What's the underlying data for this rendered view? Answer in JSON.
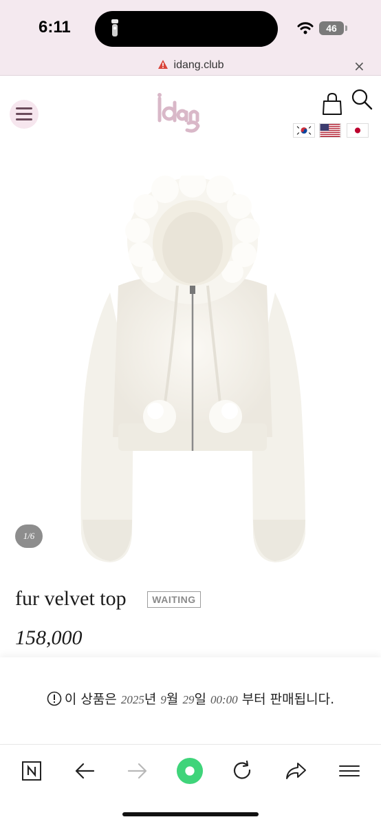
{
  "status_bar": {
    "time": "6:11",
    "battery": "46"
  },
  "url_bar": {
    "domain": "idang.club"
  },
  "header": {
    "logo_text": "idang",
    "flags": [
      "korea-flag",
      "usa-flag",
      "japan-flag"
    ]
  },
  "product": {
    "image_counter": "1/6",
    "title": "fur velvet top",
    "badge": "WAITING",
    "price": "158,000"
  },
  "notice": {
    "prefix": "이 상품은",
    "year": "2025",
    "year_unit": "년",
    "month": "9",
    "month_unit": "월",
    "day": "29",
    "day_unit": "일",
    "time": "00:00",
    "suffix": "부터 판매됩니다."
  },
  "toolbar": {
    "icons": [
      "n-tab-icon",
      "back-arrow-icon",
      "forward-arrow-icon",
      "home-circle-icon",
      "reload-icon",
      "share-icon",
      "menu-icon"
    ],
    "accent_color": "#3fd47a"
  }
}
